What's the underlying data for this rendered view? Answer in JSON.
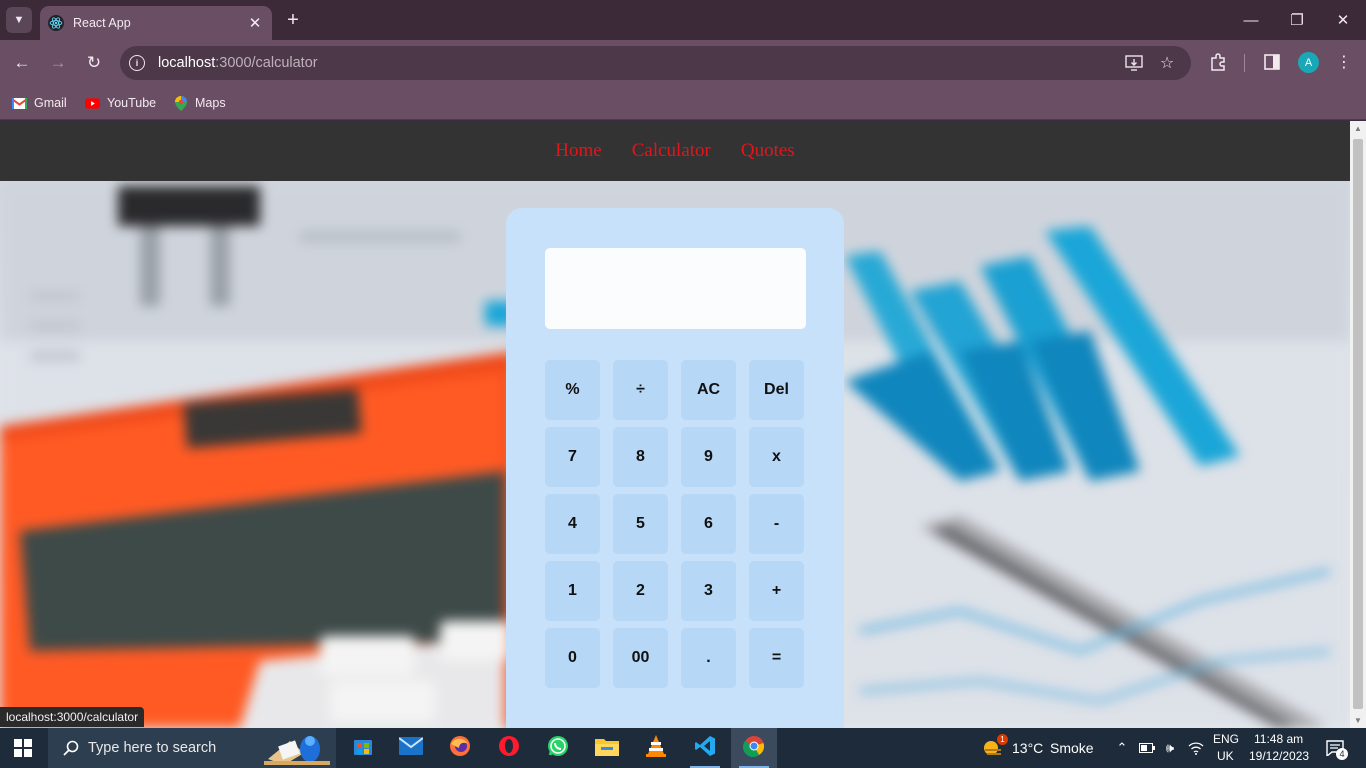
{
  "browser": {
    "tab_title": "React App",
    "url_host": "localhost",
    "url_path": ":3000/calculator",
    "bookmarks": [
      {
        "label": "Gmail",
        "icon": "gmail-icon"
      },
      {
        "label": "YouTube",
        "icon": "youtube-icon"
      },
      {
        "label": "Maps",
        "icon": "maps-icon"
      }
    ],
    "profile_initial": "A",
    "status_url": "localhost:3000/calculator"
  },
  "nav": {
    "links": [
      "Home",
      "Calculator",
      "Quotes"
    ],
    "link_color": "#e3151b",
    "bar_color": "#333333"
  },
  "calculator": {
    "display_value": "",
    "keys": [
      [
        "%",
        "÷",
        "AC",
        "Del"
      ],
      [
        "7",
        "8",
        "9",
        "x"
      ],
      [
        "4",
        "5",
        "6",
        "-"
      ],
      [
        "1",
        "2",
        "3",
        "+"
      ],
      [
        "0",
        "00",
        ".",
        "="
      ]
    ],
    "body_color": "#c8e1fa",
    "key_color": "#b6d7f6"
  },
  "taskbar": {
    "search_placeholder": "Type here to search",
    "weather_temp": "13°C",
    "weather_desc": "Smoke",
    "weather_badge": "1",
    "lang_line1": "ENG",
    "lang_line2": "UK",
    "time": "11:48 am",
    "date": "19/12/2023",
    "notification_count": "4",
    "apps": [
      "task-view",
      "microsoft-store",
      "mail",
      "firefox",
      "opera",
      "whatsapp",
      "file-explorer",
      "vlc",
      "vscode",
      "chrome"
    ]
  }
}
